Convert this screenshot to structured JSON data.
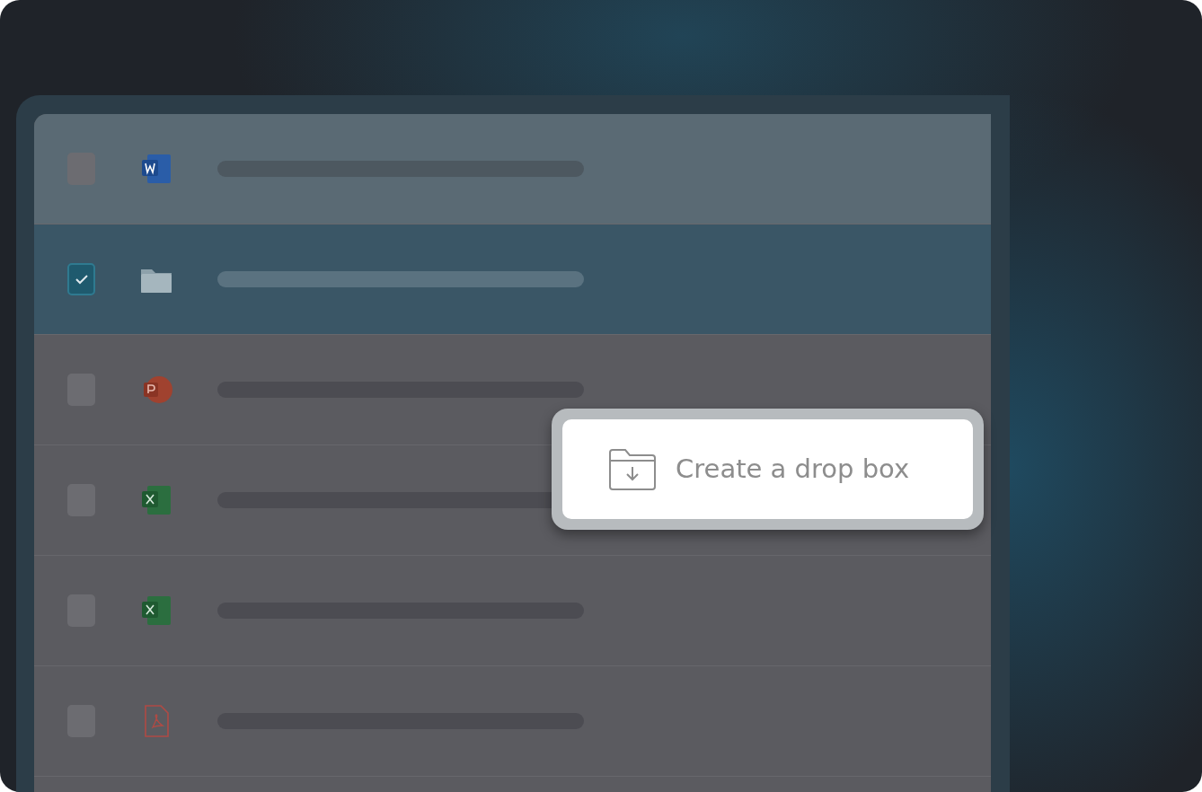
{
  "files": [
    {
      "kind": "word",
      "checked": false,
      "selected": false
    },
    {
      "kind": "folder",
      "checked": true,
      "selected": true
    },
    {
      "kind": "powerpoint",
      "checked": false,
      "selected": false
    },
    {
      "kind": "excel",
      "checked": false,
      "selected": false
    },
    {
      "kind": "excel",
      "checked": false,
      "selected": false
    },
    {
      "kind": "pdf",
      "checked": false,
      "selected": false
    }
  ],
  "popup": {
    "label": "Create a drop box"
  }
}
